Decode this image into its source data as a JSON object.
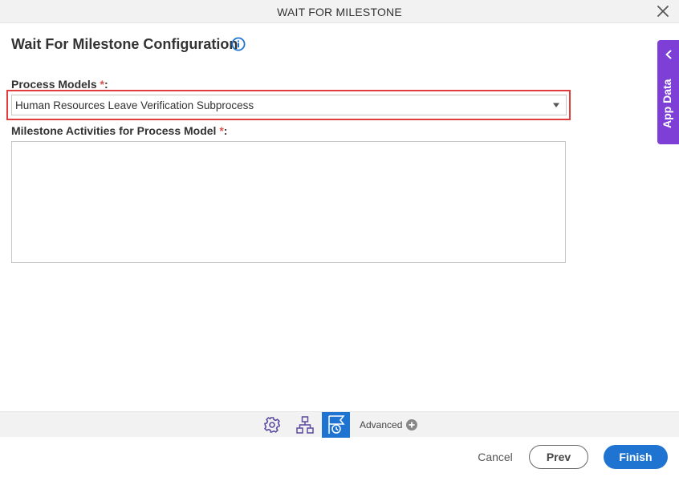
{
  "window": {
    "title": "WAIT FOR MILESTONE",
    "close_icon": "close-icon"
  },
  "main": {
    "heading": "Wait For Milestone Configuration",
    "info_icon": "info-icon",
    "process_models": {
      "label": "Process Models",
      "required_mark": "*",
      "label_suffix": ":",
      "selected_value": "Human Resources Leave Verification Subprocess"
    },
    "milestone_activities": {
      "label": "Milestone Activities for Process Model",
      "required_mark": "*",
      "label_suffix": ":",
      "items": []
    }
  },
  "side_panel": {
    "label": "App Data",
    "icon": "chevron-left-icon"
  },
  "toolbar": {
    "icons": [
      "gear-icon",
      "hierarchy-icon",
      "milestone-icon"
    ],
    "active_icon": "milestone-icon",
    "advanced_label": "Advanced",
    "advanced_icon": "plus-circle-icon"
  },
  "footer": {
    "cancel_label": "Cancel",
    "prev_label": "Prev",
    "finish_label": "Finish"
  },
  "colors": {
    "accent": "#1f73d1",
    "side_tab": "#7e3fd6",
    "required": "#d9534f",
    "highlight": "#e03c3c"
  }
}
